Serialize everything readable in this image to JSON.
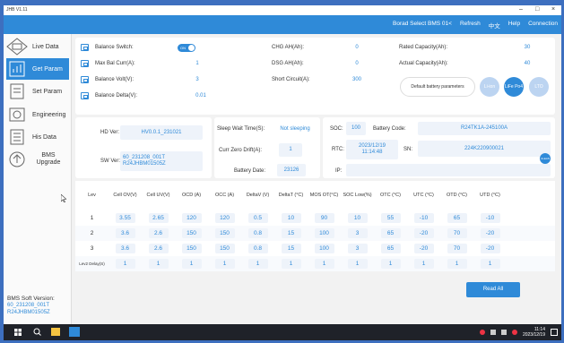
{
  "app": {
    "title": "JHB V1.11"
  },
  "window_controls": {
    "minimize": "–",
    "maximize": "□",
    "close": "×"
  },
  "menu": {
    "board_select": "Borad Select BMS 01<",
    "refresh": "Refresh",
    "lang": "中文",
    "help": "Help",
    "connection": "Connection"
  },
  "sidebar": {
    "items": [
      {
        "label": "Live Data",
        "icon": "monitor-icon"
      },
      {
        "label": "Get Param",
        "icon": "chart-icon",
        "active": true
      },
      {
        "label": "Set Param",
        "icon": "document-icon"
      },
      {
        "label": "Engineering",
        "icon": "engineering-icon"
      },
      {
        "label": "His Data",
        "icon": "list-icon"
      },
      {
        "label": "BMS Upgrade",
        "icon": "upgrade-icon"
      }
    ]
  },
  "soft": {
    "label": "BMS Soft Version:",
    "line1": "60_231208_001T",
    "line2": "R24JHBM01505Z"
  },
  "params": {
    "balance_switch": {
      "label": "Balance Switch:",
      "state": "ON"
    },
    "max_bal_curr": {
      "label": "Max Bal Curr(A):",
      "value": "1"
    },
    "balance_volt": {
      "label": "Balance Volt(V):",
      "value": "3"
    },
    "balance_delta": {
      "label": "Balance Delta(V):",
      "value": "0.01"
    },
    "chg_ah": {
      "label": "CHG AH(Ah):",
      "value": "0"
    },
    "dsg_ah": {
      "label": "DSG AH(Ah):",
      "value": "0"
    },
    "short_circuit": {
      "label": "Short Circuit(A):",
      "value": "300"
    },
    "rated_capacity": {
      "label": "Rated Capacity(Ah):",
      "value": "30"
    },
    "actual_capacity": {
      "label": "Actual Capacity(Ah):",
      "value": "40"
    },
    "default_battery": {
      "label": "Default battery parameters",
      "options": [
        "Li-ion",
        "LiFe Po4",
        "LTO"
      ],
      "selected": "LiFe Po4"
    }
  },
  "info": {
    "hd_ver": {
      "label": "HD Ver:",
      "value": "HV0.0.1_231021"
    },
    "sw_ver": {
      "label": "SW Ver:",
      "line1": "60_231208_001T",
      "line2": "R24JHBM01505Z"
    },
    "sleep_wait": {
      "label": "Sleep Wait Time(S):",
      "value": "Not sleeping"
    },
    "curr_zero": {
      "label": "Curr Zero Drift(A):",
      "value": "1"
    },
    "battery_date": {
      "label": "Battery Date:",
      "value": "23126"
    },
    "soc": {
      "label": "SOC:",
      "value": "100"
    },
    "battery_code": {
      "label": "Battery Code:",
      "value": "R24TK1A-245100A"
    },
    "rtc": {
      "label": "RTC:",
      "line1": "2023/12/19",
      "line2": "11:14:48"
    },
    "sn": {
      "label": "SN:",
      "value": "224K220900021",
      "button": "CLEAN"
    },
    "ip": {
      "label": "IP:",
      "value": ""
    }
  },
  "table": {
    "headers": [
      "Lev",
      "Cell OV(V)",
      "Cell UV(V)",
      "OCD (A)",
      "OCC (A)",
      "DeltaV (V)",
      "DeltaT (°C)",
      "MOS OT(°C)",
      "SOC Low(%)",
      "OTC (°C)",
      "UTC (°C)",
      "OTD (°C)",
      "UTD (°C)"
    ],
    "rows": [
      [
        "1",
        "3.55",
        "2.65",
        "120",
        "120",
        "0.5",
        "10",
        "90",
        "10",
        "55",
        "-10",
        "65",
        "-10"
      ],
      [
        "2",
        "3.6",
        "2.6",
        "150",
        "150",
        "0.8",
        "15",
        "100",
        "3",
        "65",
        "-20",
        "70",
        "-20"
      ],
      [
        "3",
        "3.6",
        "2.6",
        "150",
        "150",
        "0.8",
        "15",
        "100",
        "3",
        "65",
        "-20",
        "70",
        "-20"
      ],
      [
        "Lev2 Delay(S)",
        "1",
        "1",
        "1",
        "1",
        "1",
        "1",
        "1",
        "1",
        "1",
        "1",
        "1",
        "1"
      ]
    ]
  },
  "read_all": "Read All",
  "taskbar": {
    "time": "11:14",
    "date": "2023/12/19"
  }
}
